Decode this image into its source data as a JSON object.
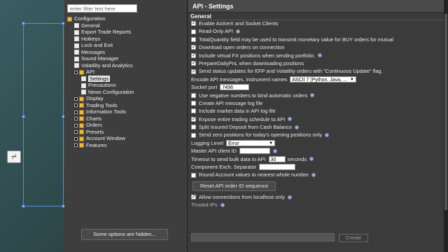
{
  "dialog": {
    "title": "API - Settings",
    "filter_placeholder": "enter filter text here",
    "hidden_button": "Some options are hidden..."
  },
  "tree": [
    {
      "label": "Configuration",
      "icon": "folder-icon",
      "depth": 0,
      "expand": ""
    },
    {
      "label": "General",
      "icon": "page-icon",
      "depth": 1,
      "expand": ""
    },
    {
      "label": "Export Trade Reports",
      "icon": "page-icon",
      "depth": 1,
      "expand": ""
    },
    {
      "label": "Hotkeys",
      "icon": "page-icon",
      "depth": 1,
      "expand": ""
    },
    {
      "label": "Lock and Exit",
      "icon": "page-icon",
      "depth": 1,
      "expand": ""
    },
    {
      "label": "Messages",
      "icon": "page-icon",
      "depth": 1,
      "expand": ""
    },
    {
      "label": "Sound Manager",
      "icon": "page-icon",
      "depth": 1,
      "expand": ""
    },
    {
      "label": "Volatility and Analytics",
      "icon": "page-icon",
      "depth": 1,
      "expand": ""
    },
    {
      "label": "API",
      "icon": "folder-icon",
      "depth": 1,
      "expand": "open"
    },
    {
      "label": "Settings",
      "icon": "page-icon",
      "depth": 2,
      "expand": "",
      "selected": true
    },
    {
      "label": "Precautions",
      "icon": "page-icon",
      "depth": 2,
      "expand": ""
    },
    {
      "label": "News Configuration",
      "icon": "page-icon",
      "depth": 2,
      "expand": ""
    },
    {
      "label": "Display",
      "icon": "folder-icon",
      "depth": 1,
      "expand": "closed"
    },
    {
      "label": "Trading Tools",
      "icon": "folder-icon",
      "depth": 1,
      "expand": "closed"
    },
    {
      "label": "Information Tools",
      "icon": "folder-icon",
      "depth": 1,
      "expand": "closed"
    },
    {
      "label": "Charts",
      "icon": "folder-icon",
      "depth": 1,
      "expand": "closed"
    },
    {
      "label": "Orders",
      "icon": "folder-icon",
      "depth": 1,
      "expand": "closed"
    },
    {
      "label": "Presets",
      "icon": "folder-icon",
      "depth": 1,
      "expand": "closed"
    },
    {
      "label": "Account Window",
      "icon": "folder-icon",
      "depth": 1,
      "expand": "closed"
    },
    {
      "label": "Features",
      "icon": "folder-icon",
      "depth": 1,
      "expand": "closed"
    }
  ],
  "settings": {
    "section_title": "General",
    "checkboxes_top": [
      {
        "label": "Enable ActiveX and Socket Clients",
        "checked": true,
        "info": false
      },
      {
        "label": "Read-Only API",
        "checked": false,
        "info": true
      },
      {
        "label": "TotalQuantity field may be used to transmit monetary value for BUY orders for mutual",
        "checked": false,
        "info": false
      },
      {
        "label": "Download open orders on connection",
        "checked": true,
        "info": false
      },
      {
        "label": "Include virtual FX positions when sending portfolio.",
        "checked": true,
        "info": true
      },
      {
        "label": "PrepareDailyPnL when downloading positions",
        "checked": true,
        "info": false
      },
      {
        "label": "Send status updates for EFP and Volatility orders with \"Continuous Update\" flag.",
        "checked": true,
        "info": false
      }
    ],
    "encode_label": "Encode API messages, instrument names",
    "encode_value": "ASCII 7 (Python, Java, ...",
    "socket_port_label": "Socket port",
    "socket_port_value": "7496",
    "checkboxes_mid": [
      {
        "label": "Use negative numbers to bind automatic orders",
        "checked": false,
        "info": true
      },
      {
        "label": "Create API message log file",
        "checked": false,
        "info": false
      },
      {
        "label": "Include market data in API log file",
        "checked": false,
        "info": false
      },
      {
        "label": "Expose entire trading schedule to API",
        "checked": true,
        "info": true
      },
      {
        "label": "Split Insured Deposit from Cash Balance",
        "checked": false,
        "info": true
      },
      {
        "label": "Send zero positions for today's opening positions only",
        "checked": false,
        "info": true
      }
    ],
    "logging_label": "Logging Level",
    "logging_value": "Error",
    "master_id_label": "Master API client ID",
    "master_id_value": "",
    "timeout_label": "Timeout to send bulk data to API",
    "timeout_value": "30",
    "timeout_unit": "seconds",
    "comp_sep_label": "Component Exch. Separator",
    "comp_sep_value": "",
    "round_label": "Round Account values to nearest whole number",
    "reset_button": "Reset API order ID sequence",
    "localhost_label": "Allow connections from localhost only",
    "trusted_label": "Trusted IPs",
    "create_button": "Create"
  }
}
